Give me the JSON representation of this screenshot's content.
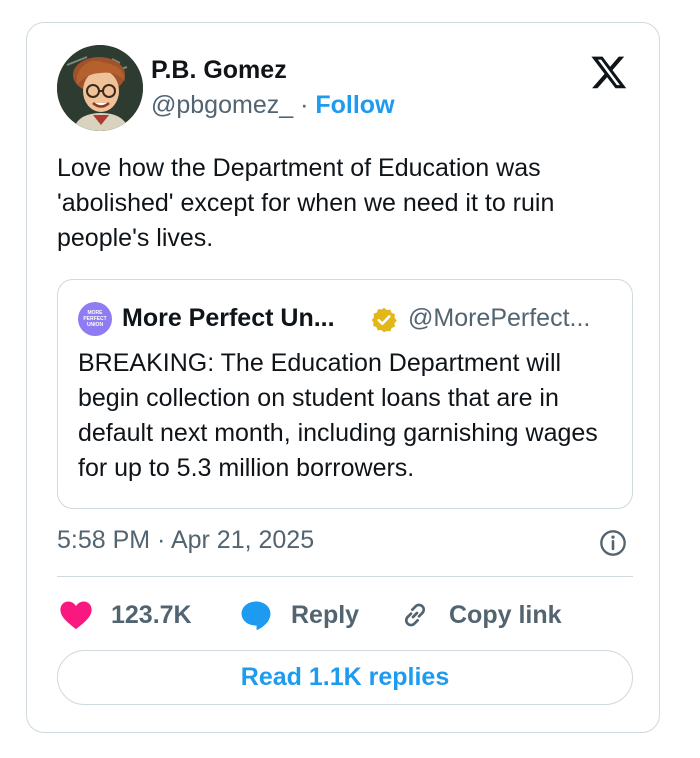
{
  "author": {
    "name": "P.B. Gomez",
    "handle": "@pbgomez_",
    "separator": "·",
    "follow_label": "Follow"
  },
  "tweet": {
    "text": "Love how the Department of Education was 'abolished' except for when we need it to ruin people's lives.",
    "timestamp": "5:58 PM · Apr 21, 2025"
  },
  "quoted": {
    "avatar_text": [
      "MORE",
      "PERFECT",
      "UNION"
    ],
    "name": "More Perfect Un...",
    "handle": "@MorePerfect...",
    "text": "BREAKING: The Education Department will begin collection on student loans that are in default next month, including garnishing wages for up to 5.3 million borrowers."
  },
  "actions": {
    "likes_count": "123.7K",
    "reply_label": "Reply",
    "copy_label": "Copy link",
    "read_replies_label": "Read 1.1K replies"
  },
  "icons": {
    "logo": "x-logo-icon",
    "verified": "verified-badge-icon",
    "info": "info-icon",
    "like": "heart-icon",
    "reply": "reply-bubble-icon",
    "copy": "link-icon"
  },
  "colors": {
    "accent": "#1d9bf0",
    "like": "#f91880",
    "muted": "#536471",
    "verified": "#e2b719"
  }
}
